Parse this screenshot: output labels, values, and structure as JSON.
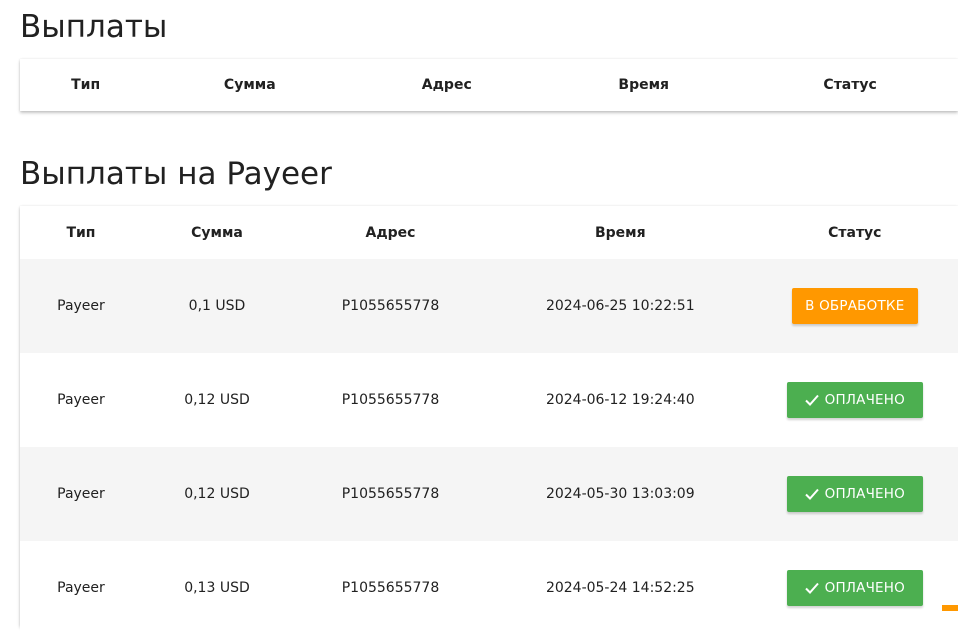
{
  "sections": [
    {
      "title": "Выплаты",
      "headers": [
        "Тип",
        "Сумма",
        "Адрес",
        "Время",
        "Статус"
      ]
    },
    {
      "title": "Выплаты на Payeer",
      "headers": [
        "Тип",
        "Сумма",
        "Адрес",
        "Время",
        "Статус"
      ],
      "rows": [
        {
          "type": "Payeer",
          "amount": "0,1 USD",
          "address": "P1055655778",
          "time": "2024-06-25 10:22:51",
          "status": "В ОБРАБОТКЕ"
        },
        {
          "type": "Payeer",
          "amount": "0,12 USD",
          "address": "P1055655778",
          "time": "2024-06-12 19:24:40",
          "status": "ОПЛАЧЕНО"
        },
        {
          "type": "Payeer",
          "amount": "0,12 USD",
          "address": "P1055655778",
          "time": "2024-05-30 13:03:09",
          "status": "ОПЛАЧЕНО"
        },
        {
          "type": "Payeer",
          "amount": "0,13 USD",
          "address": "P1055655778",
          "time": "2024-05-24 14:52:25",
          "status": "ОПЛАЧЕНО"
        }
      ]
    }
  ],
  "colors": {
    "processing": "#ff9800",
    "paid": "#4caf50",
    "row_stripe": "#f5f5f5"
  },
  "icons": {
    "paid_status": "check-icon"
  }
}
